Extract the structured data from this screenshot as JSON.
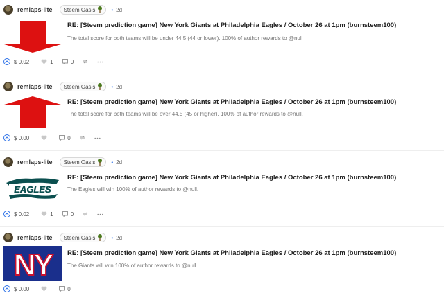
{
  "posts": [
    {
      "author": "remlaps-lite",
      "community": "Steem Oasis",
      "age": "2d",
      "title": "RE: [Steem prediction game] New York Giants at Philadelphia Eagles / October 26 at 1pm (burnsteem100)",
      "body": "The total score for both teams will be under 44.5 (44 or lower). 100% of author rewards to @null",
      "thumbnail": "red-down-arrow",
      "payout": "$ 0.02",
      "votes": "1",
      "comments": "0"
    },
    {
      "author": "remlaps-lite",
      "community": "Steem Oasis",
      "age": "2d",
      "title": "RE: [Steem prediction game] New York Giants at Philadelphia Eagles / October 26 at 1pm (burnsteem100)",
      "body": "The total score for both teams will be over 44.5 (45 or higher). 100% of author rewards to @null.",
      "thumbnail": "red-up-arrow",
      "payout": "$ 0.00",
      "votes": "",
      "comments": "0"
    },
    {
      "author": "remlaps-lite",
      "community": "Steem Oasis",
      "age": "2d",
      "title": "RE: [Steem prediction game] New York Giants at Philadelphia Eagles / October 26 at 1pm (burnsteem100)",
      "body": "The Eagles will win 100% of author rewards to @null.",
      "thumbnail": "eagles-logo",
      "thumbnail_text": "EAGLES",
      "payout": "$ 0.02",
      "votes": "1",
      "comments": "0"
    },
    {
      "author": "remlaps-lite",
      "community": "Steem Oasis",
      "age": "2d",
      "title": "RE: [Steem prediction game] New York Giants at Philadelphia Eagles / October 26 at 1pm (burnsteem100)",
      "body": "The Giants will win 100% of author rewards to @null.",
      "thumbnail": "giants-logo",
      "thumbnail_text": "NY",
      "payout": "$ 0.00",
      "votes": "",
      "comments": "0"
    }
  ],
  "icons": {
    "upvote": "upvote-icon",
    "like": "heart-icon",
    "comment": "comment-icon",
    "resteem": "resteem-icon",
    "more": "more-icon",
    "community": "tree-icon"
  },
  "colors": {
    "accent": "#2e72e8",
    "arrow_red": "#dd1111",
    "eagles_green": "#0b4f4f",
    "giants_blue": "#1a2f8c",
    "giants_red": "#c8102e"
  }
}
